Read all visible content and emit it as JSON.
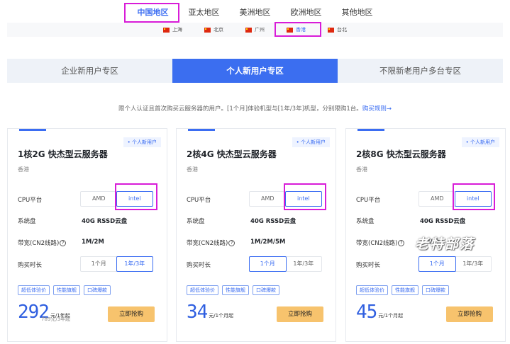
{
  "regions": [
    {
      "label": "中国地区",
      "active": true
    },
    {
      "label": "亚太地区",
      "active": false
    },
    {
      "label": "美洲地区",
      "active": false
    },
    {
      "label": "欧洲地区",
      "active": false
    },
    {
      "label": "其他地区",
      "active": false
    }
  ],
  "cities": [
    {
      "label": "上海",
      "active": false
    },
    {
      "label": "北京",
      "active": false
    },
    {
      "label": "广州",
      "active": false
    },
    {
      "label": "香港",
      "active": true
    },
    {
      "label": "台北",
      "active": false
    }
  ],
  "audience_tabs": [
    {
      "label": "企业新用户专区",
      "active": false
    },
    {
      "label": "个人新用户专区",
      "active": true
    },
    {
      "label": "不限新老用户多台专区",
      "active": false
    }
  ],
  "notice": {
    "text": "限个人认证且首次购买云服务器的用户。[1个月]体验机型与[1年/3年]机型，分别限购1台。",
    "link": "购买规则→"
  },
  "labels": {
    "cpu": "CPU平台",
    "disk": "系统盘",
    "bandwidth": "带宽(CN2线路)",
    "bandwidth_help": "?",
    "duration": "购买时长"
  },
  "cards": [
    {
      "badge": "个人新用户",
      "title": "1核2G 快杰型云服务器",
      "location": "香港",
      "cpu_options": [
        "AMD",
        "intel"
      ],
      "cpu_selected": "intel",
      "disk": "40G RSSD云盘",
      "bandwidth": "1M/2M",
      "duration_options": [
        "1个月",
        "1年/3年"
      ],
      "duration_selected": "1年/3年",
      "tags": [
        "超低体验价",
        "性能旗舰",
        "口碑爆款"
      ],
      "price": "292",
      "price_unit": "元/1年起",
      "price_sub": "789元/3年起",
      "buy_label": "立即抢购"
    },
    {
      "badge": "个人新用户",
      "title": "2核4G 快杰型云服务器",
      "location": "香港",
      "cpu_options": [
        "AMD",
        "intel"
      ],
      "cpu_selected": "intel",
      "disk": "40G RSSD云盘",
      "bandwidth": "1M/2M/5M",
      "duration_options": [
        "1个月",
        "1年/3年"
      ],
      "duration_selected": "1个月",
      "tags": [
        "超低体验价",
        "性能旗舰",
        "口碑爆款"
      ],
      "price": "34",
      "price_unit": "元/1个月起",
      "price_sub": "",
      "buy_label": "立即抢购"
    },
    {
      "badge": "个人新用户",
      "title": "2核8G 快杰型云服务器",
      "location": "香港",
      "cpu_options": [
        "AMD",
        "intel"
      ],
      "cpu_selected": "intel",
      "disk": "40G RSSD云盘",
      "bandwidth": "1M/2M",
      "duration_options": [
        "1个月",
        "1年/3年"
      ],
      "duration_selected": "1个月",
      "tags": [
        "超低体验价",
        "性能旗舰",
        "口碑爆款"
      ],
      "price": "45",
      "price_unit": "元/1个月起",
      "price_sub": "",
      "buy_label": "立即抢购"
    }
  ],
  "watermark": "老特部落",
  "colors": {
    "accent": "#3b6df2",
    "buy_button": "#f7c36d",
    "highlight": "#d81cd8"
  }
}
